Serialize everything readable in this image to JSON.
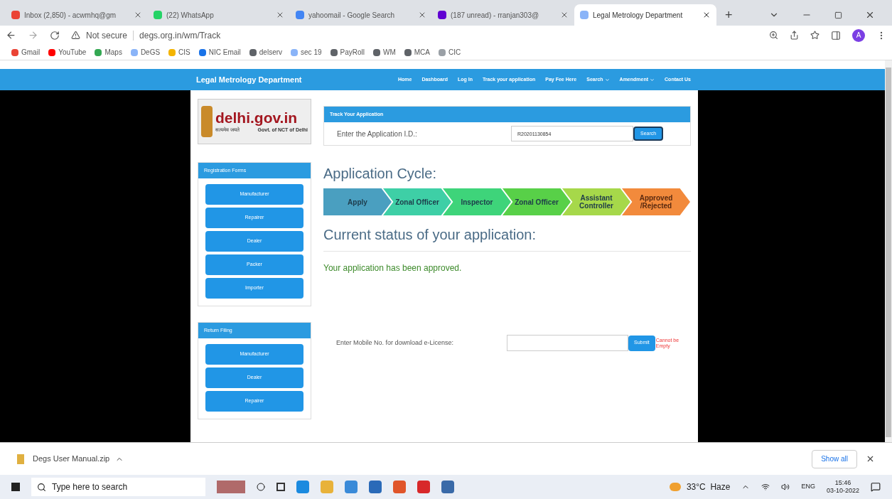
{
  "browser": {
    "tabs": [
      {
        "title": "Inbox (2,850) - acwmhq@gm",
        "selected": false,
        "kind": "gmail"
      },
      {
        "title": "(22) WhatsApp",
        "selected": false,
        "kind": "whatsapp"
      },
      {
        "title": "yahoomail - Google Search",
        "selected": false,
        "kind": "google"
      },
      {
        "title": "(187 unread) - rranjan303@",
        "selected": false,
        "kind": "mail"
      },
      {
        "title": "Legal Metrology Department",
        "selected": true,
        "kind": "page"
      }
    ],
    "new_tab": "+",
    "address": {
      "security": "Not secure",
      "url": "degs.org.in/wm/Track"
    },
    "profile": "A",
    "bookmarks": [
      {
        "label": "Gmail",
        "color": "#ea4335"
      },
      {
        "label": "YouTube",
        "color": "#ff0000"
      },
      {
        "label": "Maps",
        "color": "#34a853"
      },
      {
        "label": "DeGS",
        "color": "#8ab4f8"
      },
      {
        "label": "CIS",
        "color": "#f4b400"
      },
      {
        "label": "NIC Email",
        "color": "#1a73e8"
      },
      {
        "label": "delserv",
        "color": "#5f6368"
      },
      {
        "label": "sec 19",
        "color": "#8ab4f8"
      },
      {
        "label": "PayRoll",
        "color": "#5f6368"
      },
      {
        "label": "WM",
        "color": "#5f6368"
      },
      {
        "label": "MCA",
        "color": "#5f6368"
      },
      {
        "label": "CIC",
        "color": "#9aa0a6"
      }
    ]
  },
  "site": {
    "brand": "Legal Metrology Department",
    "nav": [
      {
        "label": "Home",
        "dropdown": false
      },
      {
        "label": "Dashboard",
        "dropdown": false
      },
      {
        "label": "Log In",
        "dropdown": false
      },
      {
        "label": "Track your application",
        "dropdown": false
      },
      {
        "label": "Pay Fee Here",
        "dropdown": false
      },
      {
        "label": "Search",
        "dropdown": true
      },
      {
        "label": "Amendment",
        "dropdown": true
      },
      {
        "label": "Contact Us",
        "dropdown": false
      }
    ],
    "logo": {
      "title": "delhi.gov.in",
      "subtitle": "Govt. of NCT of Delhi",
      "motto": "सत्यमेव जयते"
    },
    "sidebar": [
      {
        "title": "Registration Forms",
        "items": [
          "Manufacturer",
          "Repairer",
          "Dealer",
          "Packer",
          "Importer"
        ]
      },
      {
        "title": "Return Filing",
        "items": [
          "Manufacturer",
          "Dealer",
          "Repairer"
        ]
      }
    ],
    "track": {
      "title": "Track Your Application",
      "label": "Enter the Application I.D.:",
      "value": "R20201130854",
      "button": "Search"
    },
    "cycle_title": "Application Cycle:",
    "cycle": [
      {
        "label": "Apply",
        "color": "#4a9fc0"
      },
      {
        "label": "Zonal Officer",
        "color": "#3ecfa6"
      },
      {
        "label": "Inspector",
        "color": "#3ed47a"
      },
      {
        "label": "Zonal Officer",
        "color": "#58d048"
      },
      {
        "label": "Assistant Controller",
        "color": "#a6d84a"
      },
      {
        "label": "Approved /Rejected",
        "color": "#f28a3c"
      }
    ],
    "status_title": "Current status of your application:",
    "status": "Your application has been approved.",
    "download": {
      "label": "Enter Mobile No. for download e-License:",
      "button": "Submit",
      "error": "Cannot be Empty"
    }
  },
  "downloads": {
    "file": "Degs User Manual.zip",
    "show_all": "Show all"
  },
  "taskbar": {
    "search": "Type here to search",
    "weather": "33°C  Haze",
    "lang": "ENG",
    "time": "15:46",
    "date": "03-10-2022"
  }
}
